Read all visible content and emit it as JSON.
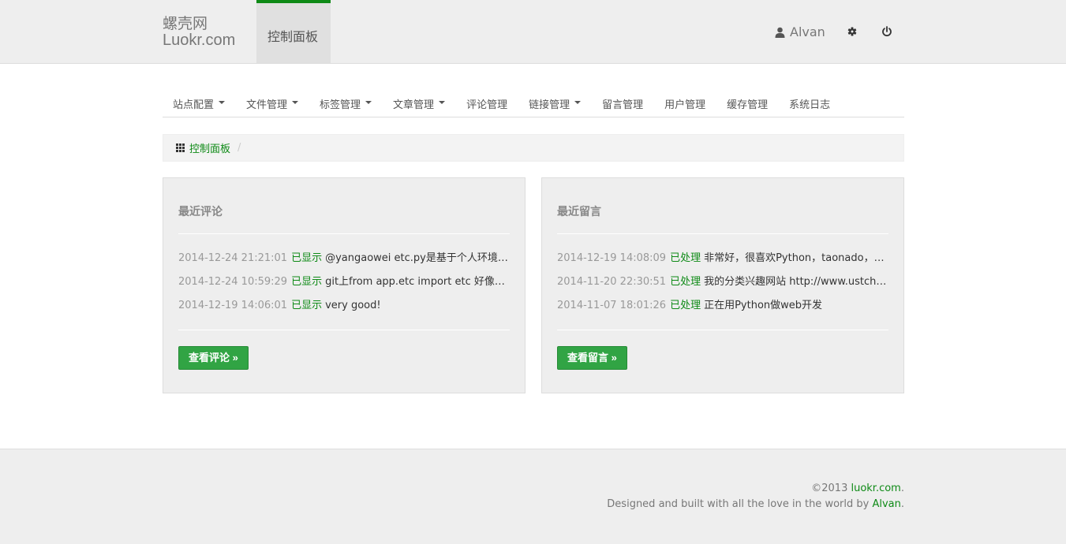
{
  "brand": {
    "line1": "螺壳网",
    "line2": "Luokr.com"
  },
  "topnav": {
    "active_label": "控制面板"
  },
  "user": {
    "name": "Alvan"
  },
  "icons": {
    "user": "user-icon",
    "settings": "gear-icon",
    "logout": "power-icon",
    "dashboard": "grid-icon"
  },
  "tabs": [
    {
      "label": "站点配置",
      "dropdown": true
    },
    {
      "label": "文件管理",
      "dropdown": true
    },
    {
      "label": "标签管理",
      "dropdown": true
    },
    {
      "label": "文章管理",
      "dropdown": true
    },
    {
      "label": "评论管理",
      "dropdown": false
    },
    {
      "label": "链接管理",
      "dropdown": true
    },
    {
      "label": "留言管理",
      "dropdown": false
    },
    {
      "label": "用户管理",
      "dropdown": false
    },
    {
      "label": "缓存管理",
      "dropdown": false
    },
    {
      "label": "系统日志",
      "dropdown": false
    }
  ],
  "breadcrumb": {
    "label": "控制面板",
    "separator": "/"
  },
  "comments": {
    "title": "最近评论",
    "items": [
      {
        "time": "2014-12-24 21:21:01",
        "status": "已显示",
        "text": "@yangaowei etc.py是基于个人环境的..."
      },
      {
        "time": "2014-12-24 10:59:29",
        "status": "已显示",
        "text": "git上from app.etc import etc 好像不..."
      },
      {
        "time": "2014-12-19 14:06:01",
        "status": "已显示",
        "text": "very good!"
      }
    ],
    "button": "查看评论 »"
  },
  "messages": {
    "title": "最近留言",
    "items": [
      {
        "time": "2014-12-19 14:08:09",
        "status": "已处理",
        "text": "非常好，很喜欢Python，taonado，对..."
      },
      {
        "time": "2014-11-20 22:30:51",
        "status": "已处理",
        "text": "我的分类兴趣网站 http://www.ustcha..."
      },
      {
        "time": "2014-11-07 18:01:26",
        "status": "已处理",
        "text": "正在用Python做web开发"
      }
    ],
    "button": "查看留言 »"
  },
  "footer": {
    "copyright_prefix": "©2013 ",
    "site_link": "luokr.com",
    "period1": ".",
    "credit_prefix": "Designed and built with all the love in the world by ",
    "author_link": "Alvan",
    "period2": "."
  },
  "colors": {
    "accent": "#0e8a16",
    "button": "#31a444",
    "panel_bg": "#eeeeee"
  }
}
